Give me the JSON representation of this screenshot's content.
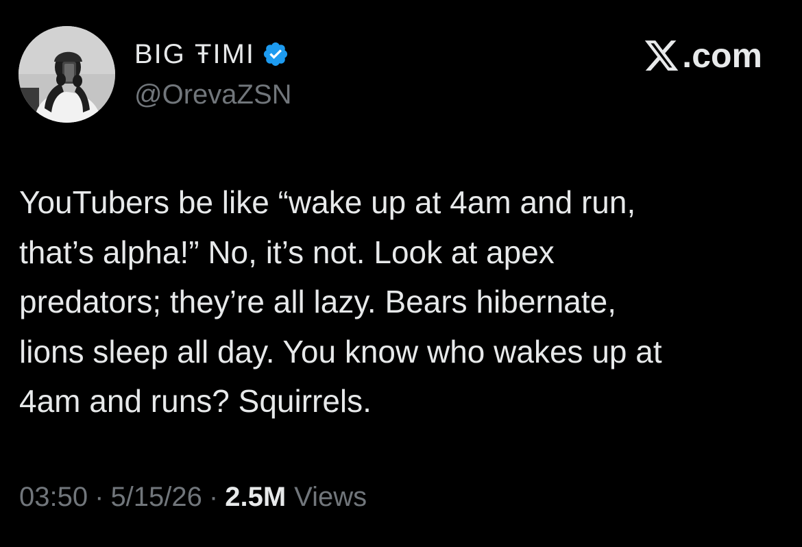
{
  "author": {
    "display_name": "BIG ŦIMI",
    "handle": "@OrevaZSN",
    "verified": true,
    "verified_icon": "verified-badge-icon",
    "avatar_icon": "profile-photo"
  },
  "brand": {
    "icon": "x-logo-icon",
    "text": ".com"
  },
  "tweet": {
    "text": "YouTubers be like “wake up at 4am and run,\nthat’s alpha!” No, it’s not. Look at apex\npredators; they’re all lazy. Bears hibernate,\nlions sleep all day. You know who wakes up at\n4am and runs? Squirrels."
  },
  "meta": {
    "time": "03:50",
    "separator": "·",
    "date": "5/15/26",
    "views_count": "2.5M",
    "views_label": "Views"
  },
  "colors": {
    "background": "#000000",
    "primary_text": "#e7e9ea",
    "secondary_text": "#71767b",
    "verified_blue": "#1d9bf0"
  }
}
